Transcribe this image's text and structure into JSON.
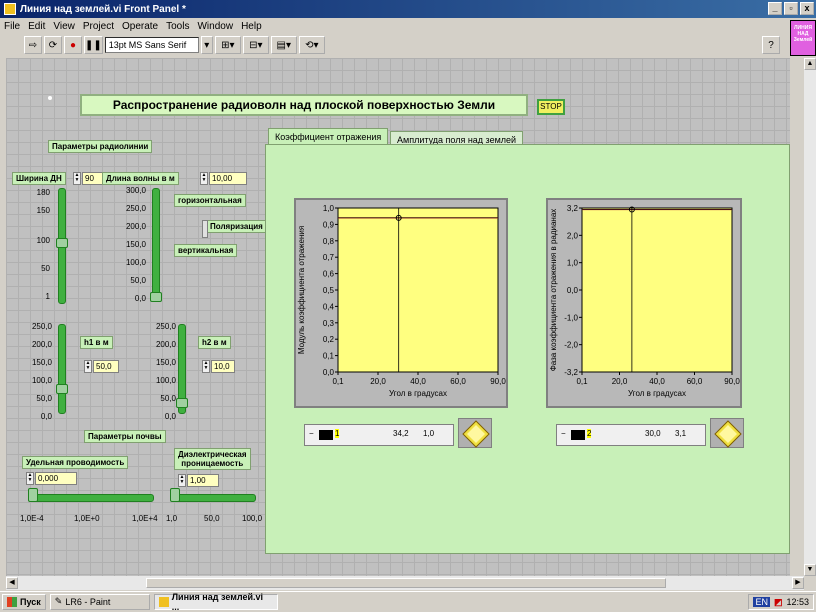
{
  "window": {
    "title": "Линия над землей.vi Front Panel *",
    "min": "_",
    "max": "▫",
    "close": "x"
  },
  "menu": [
    "File",
    "Edit",
    "View",
    "Project",
    "Operate",
    "Tools",
    "Window",
    "Help"
  ],
  "toolbar": {
    "font": "13pt MS Sans Serif",
    "help": "?"
  },
  "vi_icon": {
    "line1": "ЛИНИЯ",
    "line2": "НАД",
    "line3": "Землей"
  },
  "panel": {
    "title": "Распространение радиоволн над плоской поверхностью Земли",
    "stop": "STOP",
    "radio_params_label": "Параметры радиолинии",
    "beamwidth": {
      "label": "Ширина ДН",
      "value": "90",
      "scale": [
        "180",
        "150",
        "100",
        "50",
        "1"
      ]
    },
    "wavelength": {
      "label": "Длина волны в м",
      "value": "10,00",
      "scale": [
        "300,0",
        "250,0",
        "200,0",
        "150,0",
        "100,0",
        "50,0",
        "0,0"
      ]
    },
    "polarization": {
      "top": "горизонтальная",
      "label": "Поляризация",
      "bottom": "вертикальная"
    },
    "h1": {
      "label": "h1 в м",
      "value": "50,0",
      "scale": [
        "250,0",
        "200,0",
        "150,0",
        "100,0",
        "50,0",
        "0,0"
      ]
    },
    "h2": {
      "label": "h2 в м",
      "value": "10,0",
      "scale": [
        "250,0",
        "200,0",
        "150,0",
        "100,0",
        "50,0",
        "0,0"
      ]
    },
    "soil_params_label": "Параметры почвы",
    "conductivity": {
      "label": "Удельная проводимость",
      "value": "0,000",
      "scale": [
        "1,0E-4",
        "1,0E+0",
        "1,0E+4"
      ]
    },
    "permittivity": {
      "label1": "Диэлектрическая",
      "label2": "проницаемость",
      "value": "1,00",
      "scale": [
        "1,0",
        "50,0",
        "100,0"
      ]
    }
  },
  "tabs": [
    {
      "label": "Коэффициент отражения",
      "active": true
    },
    {
      "label": "Амплитуда поля над землей",
      "active": false
    }
  ],
  "graph1": {
    "ylabel": "Модуль коэффициента отражения",
    "xlabel": "Угол в градусах",
    "yticks": [
      "1,0",
      "0,9",
      "0,8",
      "0,7",
      "0,6",
      "0,5",
      "0,4",
      "0,3",
      "0,2",
      "0,1",
      "0,0"
    ],
    "xticks": [
      "0,1",
      "20,0",
      "40,0",
      "60,0",
      "90,0"
    ],
    "cursor": {
      "index": "1",
      "x": "34,2",
      "y": "1,0",
      "minus": "−"
    }
  },
  "graph2": {
    "ylabel": "Фаза коэффициента отражения в радианах",
    "xlabel": "Угол в градусах",
    "yticks": [
      "3,2",
      "2,0",
      "1,0",
      "0,0",
      "-1,0",
      "-2,0",
      "-3,2"
    ],
    "xticks": [
      "0,1",
      "20,0",
      "40,0",
      "60,0",
      "90,0"
    ],
    "cursor": {
      "index": "2",
      "x": "30,0",
      "y": "3,1",
      "minus": "−"
    }
  },
  "taskbar": {
    "start": "Пуск",
    "paint": "LR6 - Paint",
    "vi": "Линия над землей.vi ...",
    "lang": "EN",
    "time": "12:53"
  },
  "chart_data": [
    {
      "type": "line",
      "title": "",
      "xlabel": "Угол в градусах",
      "ylabel": "Модуль коэффициента отражения",
      "xlim": [
        0.1,
        90
      ],
      "ylim": [
        0,
        1
      ],
      "series": [
        {
          "x": [
            0.1,
            90
          ],
          "values": [
            0.94,
            0.94
          ]
        }
      ],
      "cursor": {
        "x": 34.2,
        "y": 1.0
      }
    },
    {
      "type": "line",
      "title": "",
      "xlabel": "Угол в градусах",
      "ylabel": "Фаза коэффициента отражения в радианах",
      "xlim": [
        0.1,
        90
      ],
      "ylim": [
        -3.2,
        3.2
      ],
      "series": [
        {
          "x": [
            0.1,
            90
          ],
          "values": [
            3.14,
            3.14
          ]
        }
      ],
      "cursor": {
        "x": 30.0,
        "y": 3.1
      }
    }
  ],
  "colors": {
    "plot_bg": "#ffff80",
    "panel_green": "#c8f0b8",
    "slider_green": "#40b040"
  }
}
